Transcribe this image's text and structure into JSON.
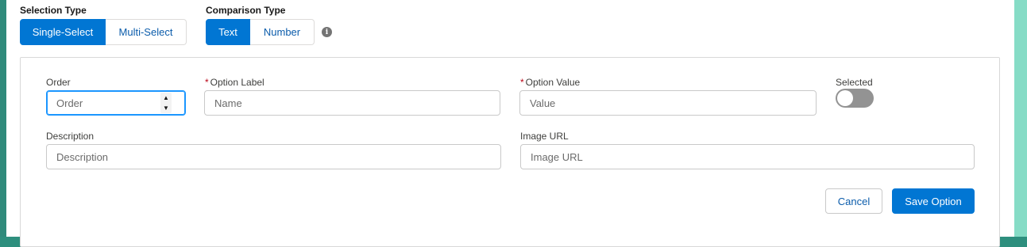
{
  "selection_type": {
    "label": "Selection Type",
    "options": [
      "Single-Select",
      "Multi-Select"
    ],
    "selected": "Single-Select"
  },
  "comparison_type": {
    "label": "Comparison Type",
    "options": [
      "Text",
      "Number"
    ],
    "selected": "Text",
    "info_icon": "info-icon"
  },
  "form": {
    "order": {
      "label": "Order",
      "placeholder": "Order",
      "value": ""
    },
    "option_label": {
      "label": "Option Label",
      "required_marker": "*",
      "placeholder": "Name",
      "value": ""
    },
    "option_value": {
      "label": "Option Value",
      "required_marker": "*",
      "placeholder": "Value",
      "value": ""
    },
    "selected": {
      "label": "Selected",
      "checked": false
    },
    "description": {
      "label": "Description",
      "placeholder": "Description",
      "value": ""
    },
    "image_url": {
      "label": "Image URL",
      "placeholder": "Image URL",
      "value": ""
    }
  },
  "actions": {
    "cancel_label": "Cancel",
    "save_label": "Save Option"
  },
  "colors": {
    "brand": "#0176d3",
    "link": "#0b5cab",
    "border": "#c9c9c9",
    "focus": "#1b96ff",
    "required": "#ba0517",
    "toggle_off": "#939393",
    "page_edge": "#2e8f7e"
  }
}
